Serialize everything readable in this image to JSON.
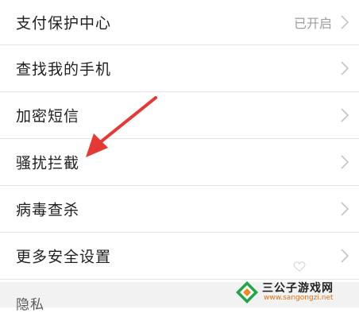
{
  "settings": {
    "rows": [
      {
        "label": "支付保护中心",
        "status": "已开启"
      },
      {
        "label": "查找我的手机"
      },
      {
        "label": "加密短信"
      },
      {
        "label": "骚扰拦截"
      },
      {
        "label": "病毒查杀"
      },
      {
        "label": "更多安全设置"
      }
    ],
    "section_title": "隐私"
  },
  "icons": {
    "row_arrow": "chevron-right-icon",
    "annotation": "red-arrow-icon"
  },
  "colors": {
    "annotation_arrow": "#e53935",
    "chevron": "#c4c4c4",
    "section_bg": "#f2f2f2"
  },
  "watermark": {
    "name": "三公子游戏网",
    "url": "www.sangongzi.net"
  }
}
